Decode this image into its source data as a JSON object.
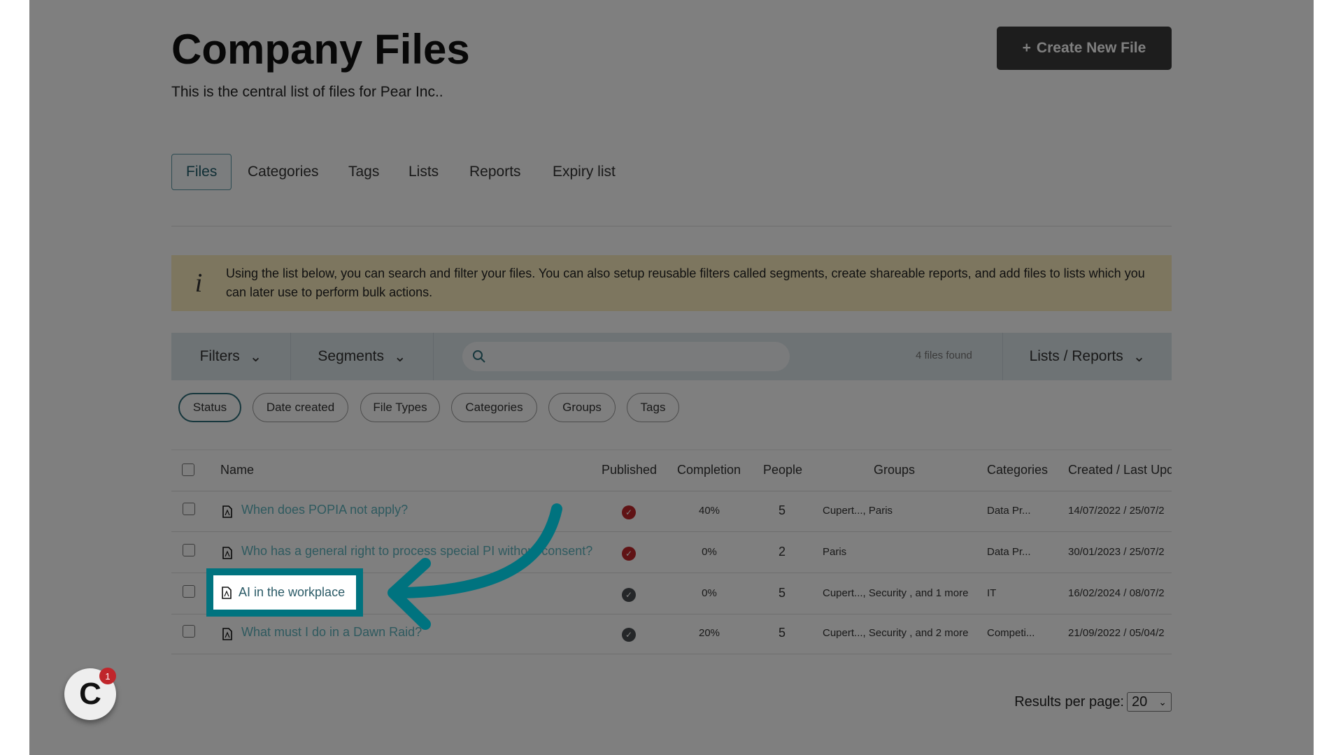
{
  "header": {
    "title": "Company Files",
    "subtitle": "This is the central list of files for Pear Inc..",
    "create_button": "Create New File",
    "create_icon": "+"
  },
  "tabs": [
    {
      "label": "Files",
      "active": true
    },
    {
      "label": "Categories"
    },
    {
      "label": "Tags"
    },
    {
      "label": "Lists"
    },
    {
      "label": "Reports"
    },
    {
      "label": "Expiry list"
    }
  ],
  "info": {
    "icon": "i",
    "text": "Using the list below, you can search and filter your files. You can also setup reusable filters called segments, create shareable reports, and add files to lists which you can later use to perform bulk actions."
  },
  "toolbar": {
    "filters": "Filters",
    "segments": "Segments",
    "search_placeholder": "",
    "found": "4 files found",
    "lists_reports": "Lists / Reports"
  },
  "chips": [
    "Status",
    "Date created",
    "File Types",
    "Categories",
    "Groups",
    "Tags"
  ],
  "table": {
    "headers": [
      "Name",
      "Published",
      "Completion",
      "People",
      "Groups",
      "Categories",
      "Created / Last Upd"
    ],
    "rows": [
      {
        "name": "When does POPIA not apply?",
        "published_status": "red",
        "completion": "40%",
        "people": "5",
        "groups": "Cupert..., Paris",
        "categories": "Data Pr...",
        "dates": "14/07/2022 / 25/07/2"
      },
      {
        "name": "Who has a general right to process special PI without consent?",
        "published_status": "red",
        "completion": "0%",
        "people": "2",
        "groups": "Paris",
        "categories": "Data Pr...",
        "dates": "30/01/2023 / 25/07/2"
      },
      {
        "name": "AI in the workplace",
        "published_status": "gray",
        "completion": "0%",
        "people": "5",
        "groups": "Cupert..., Security , and 1 more",
        "categories": "IT",
        "dates": "16/02/2024 / 08/07/2"
      },
      {
        "name": "What must I do in a Dawn Raid?",
        "published_status": "gray",
        "completion": "20%",
        "people": "5",
        "groups": "Cupert..., Security , and 2 more",
        "categories": "Competi...",
        "dates": "21/09/2022 / 05/04/2"
      }
    ]
  },
  "pagination": {
    "label": "Results per page:",
    "value": "20"
  },
  "widget": {
    "badge": "1"
  },
  "colors": {
    "accent": "#00737f",
    "published_red": "#c0262b",
    "published_gray": "#4a4f52",
    "overlay": "rgba(0,0,0,0.5)"
  }
}
